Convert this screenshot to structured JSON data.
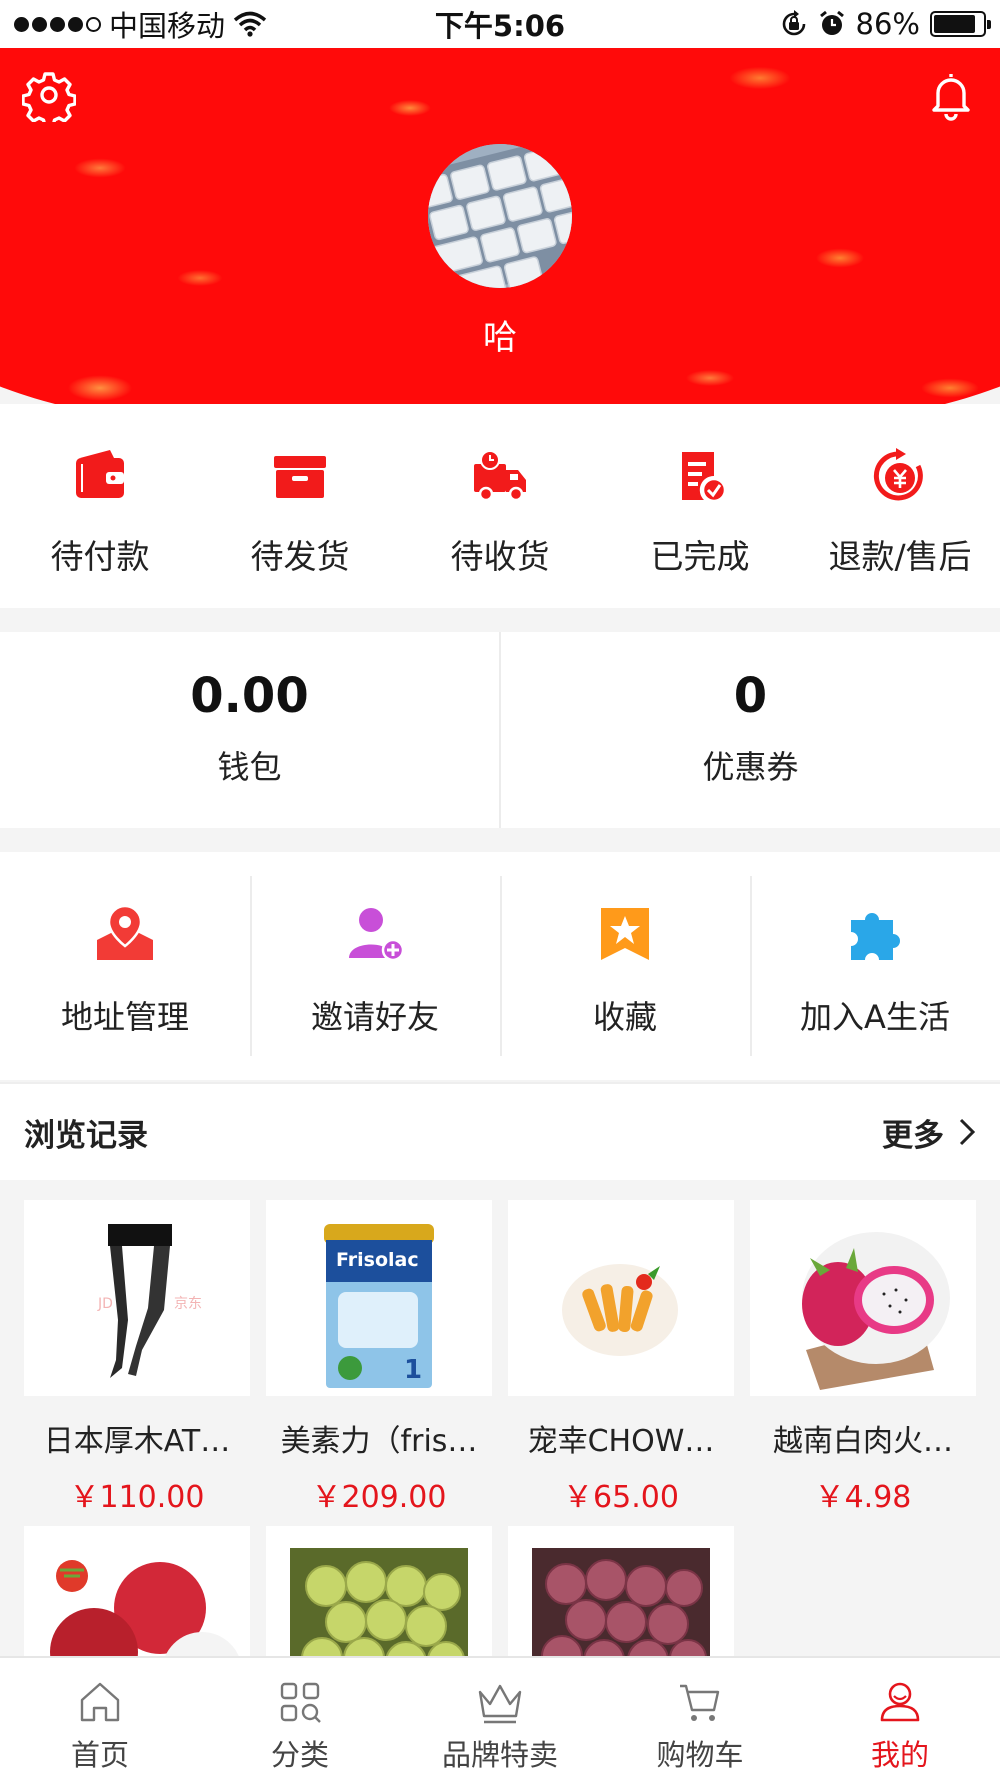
{
  "status_bar": {
    "carrier": "中国移动",
    "time": "下午5:06",
    "battery": "86%",
    "battery_level": 0.86,
    "signal_bars_filled": 4,
    "signal_bars_total": 5
  },
  "header": {
    "username": "哈",
    "settings_icon": "gear-icon",
    "notification_icon": "bell-icon",
    "background_color": "#ff0a0a"
  },
  "orders": [
    {
      "label": "待付款",
      "icon": "wallet-icon"
    },
    {
      "label": "待发货",
      "icon": "box-icon"
    },
    {
      "label": "待收货",
      "icon": "truck-icon"
    },
    {
      "label": "已完成",
      "icon": "checklist-icon"
    },
    {
      "label": "退款/售后",
      "icon": "refund-icon"
    }
  ],
  "wallet": {
    "balance": "0.00",
    "balance_label": "钱包",
    "coupons": "0",
    "coupons_label": "优惠券"
  },
  "services": [
    {
      "label": "地址管理",
      "icon": "location-icon",
      "color": "#f23b36"
    },
    {
      "label": "邀请好友",
      "icon": "add-user-icon",
      "color": "#c84fd8"
    },
    {
      "label": "收藏",
      "icon": "star-bookmark-icon",
      "color": "#ff9a1a"
    },
    {
      "label": "加入A生活",
      "icon": "puzzle-icon",
      "color": "#2aa7e8"
    }
  ],
  "history": {
    "title": "浏览记录",
    "more_label": "更多",
    "items": [
      {
        "name": "日本厚木AT…",
        "price": "￥110.00",
        "image": "stockings-image"
      },
      {
        "name": "美素力（fris…",
        "price": "￥209.00",
        "image": "milk-powder-image"
      },
      {
        "name": "宠幸CHOW…",
        "price": "￥65.00",
        "image": "fried-shrimp-image"
      },
      {
        "name": "越南白肉火…",
        "price": "￥4.98",
        "image": "dragon-fruit-image"
      },
      {
        "name": "",
        "price": "",
        "image": "lychee-image"
      },
      {
        "name": "",
        "price": "",
        "image": "green-grapes-image"
      },
      {
        "name": "",
        "price": "",
        "image": "red-grapes-image"
      }
    ]
  },
  "tabbar": {
    "active": "我的",
    "accent_color": "#e4151c",
    "tabs": [
      {
        "label": "首页",
        "icon": "home-icon"
      },
      {
        "label": "分类",
        "icon": "category-icon"
      },
      {
        "label": "品牌特卖",
        "icon": "crown-icon"
      },
      {
        "label": "购物车",
        "icon": "cart-icon"
      },
      {
        "label": "我的",
        "icon": "profile-icon"
      }
    ]
  }
}
